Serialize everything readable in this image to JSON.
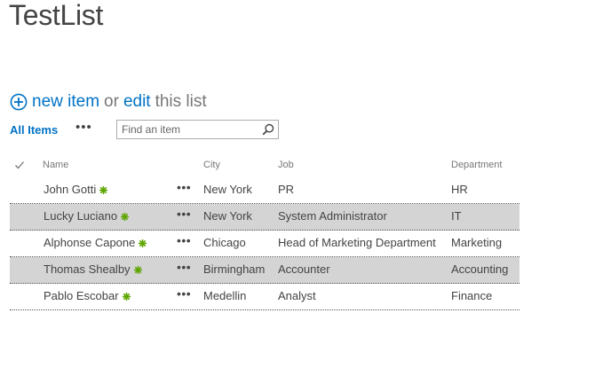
{
  "page": {
    "title": "TestList"
  },
  "actions": {
    "new_item_label": "new item",
    "connector": "or",
    "edit_label": "edit",
    "this_list_label": "this list"
  },
  "view": {
    "current_view": "All Items",
    "more_glyph": "•••",
    "search_placeholder": "Find an item"
  },
  "table": {
    "columns": {
      "name": "Name",
      "city": "City",
      "job": "Job",
      "department": "Department"
    },
    "row_menu_glyph": "•••",
    "rows": [
      {
        "name": "John Gotti",
        "city": "New York",
        "job": "PR",
        "department": "HR",
        "is_new": true
      },
      {
        "name": "Lucky Luciano",
        "city": "New York",
        "job": "System Administrator",
        "department": "IT",
        "is_new": true
      },
      {
        "name": "Alphonse Capone",
        "city": "Chicago",
        "job": "Head of Marketing Department",
        "department": "Marketing",
        "is_new": true
      },
      {
        "name": "Thomas Shealby",
        "city": "Birmingham",
        "job": "Accounter",
        "department": "Accounting",
        "is_new": true
      },
      {
        "name": "Pablo Escobar",
        "city": "Medellin",
        "job": "Analyst",
        "department": "Finance",
        "is_new": true
      }
    ]
  },
  "colors": {
    "link_blue": "#0072c6",
    "new_badge_green": "#5ea500",
    "alt_row_gray": "#d4d4d4"
  },
  "icons": {
    "add": "plus-circle-icon",
    "search": "search-icon",
    "new_badge": "new-item-icon",
    "select_all": "checkmark-icon"
  }
}
